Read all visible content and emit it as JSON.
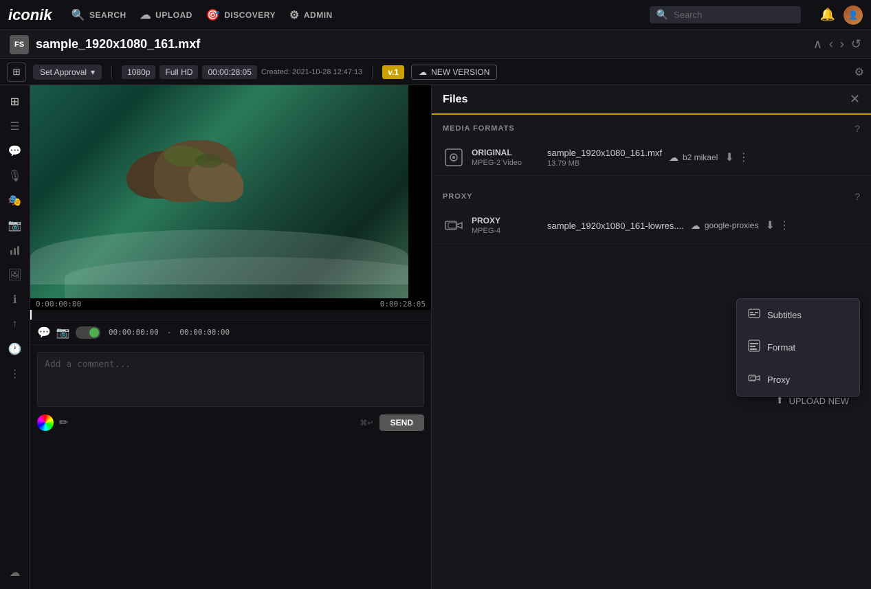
{
  "app": {
    "logo": "iconik",
    "nav": [
      {
        "id": "search",
        "label": "SEARCH",
        "icon": "🔍"
      },
      {
        "id": "upload",
        "label": "UPLOAD",
        "icon": "☁"
      },
      {
        "id": "discovery",
        "label": "DISCOVERY",
        "icon": "🎯"
      },
      {
        "id": "admin",
        "label": "ADMIN",
        "icon": "⚙"
      }
    ],
    "search_placeholder": "Search"
  },
  "file_header": {
    "fs_badge": "FS",
    "title": "sample_1920x1080_161.mxf"
  },
  "sub_header": {
    "approval_label": "Set Approval",
    "resolution": "1080p",
    "quality": "Full HD",
    "duration": "00:00:28:05",
    "created": "Created: 2021-10-28 12:47:13",
    "version": "v.1",
    "new_version_label": "NEW VERSION"
  },
  "video": {
    "timecode_start": "0:00:00:00",
    "timecode_end": "0:00:28:05",
    "controls": {
      "toggle_timecode_start": "00:00:00:00",
      "toggle_separator": "-",
      "toggle_timecode_end": "00:00:00:00"
    }
  },
  "comment": {
    "placeholder": "Add a comment...",
    "shortcut": "⌘↵",
    "send_label": "SEND"
  },
  "files_panel": {
    "title": "Files",
    "sections": [
      {
        "id": "media-formats",
        "title": "MEDIA FORMATS",
        "files": [
          {
            "type_label": "ORIGINAL",
            "codec": "MPEG-2 Video",
            "filename": "sample_1920x1080_161.mxf",
            "size": "13.79 MB",
            "cloud": "b2 mikael"
          }
        ]
      },
      {
        "id": "proxy",
        "title": "PROXY",
        "files": [
          {
            "type_label": "PROXY",
            "codec": "MPEG-4",
            "filename": "sample_1920x1080_161-lowres....",
            "size": "",
            "cloud": "google-proxies"
          }
        ]
      }
    ],
    "upload_new_label": "UPLOAD NEW"
  },
  "dropdown_menu": {
    "items": [
      {
        "id": "subtitles",
        "label": "Subtitles",
        "icon": "⬜"
      },
      {
        "id": "format",
        "label": "Format",
        "icon": "📊"
      },
      {
        "id": "proxy",
        "label": "Proxy",
        "icon": "🔗"
      }
    ]
  },
  "sidebar": {
    "top_icons": [
      {
        "id": "grid",
        "symbol": "⊞"
      },
      {
        "id": "list",
        "symbol": "☰"
      },
      {
        "id": "comment",
        "symbol": "💬"
      },
      {
        "id": "voice",
        "symbol": "🎙"
      },
      {
        "id": "mask",
        "symbol": "🎭"
      },
      {
        "id": "camera",
        "symbol": "📷"
      },
      {
        "id": "chart",
        "symbol": "📈"
      },
      {
        "id": "image",
        "symbol": "🖼"
      },
      {
        "id": "info",
        "symbol": "ℹ"
      },
      {
        "id": "share",
        "symbol": "↑"
      },
      {
        "id": "clock",
        "symbol": "🕐"
      },
      {
        "id": "hierarchy",
        "symbol": "⋮"
      }
    ],
    "bottom_icons": [
      {
        "id": "upload",
        "symbol": "☁"
      }
    ]
  }
}
